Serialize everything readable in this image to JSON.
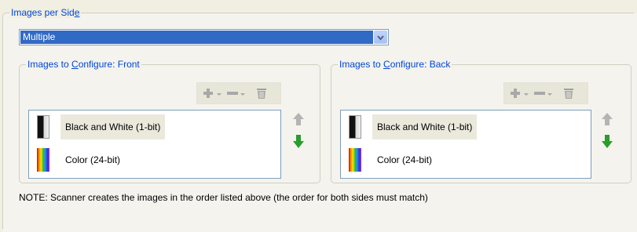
{
  "images_per_side": {
    "legend_prefix": "Images per Sid",
    "legend_hotkey": "e",
    "selected_value": "Multiple"
  },
  "front_panel": {
    "legend_prefix": "Images to ",
    "legend_hotkey": "C",
    "legend_suffix": "onfigure: Front",
    "items": [
      {
        "label": "Black and White (1-bit)",
        "icon": "black-white-icon"
      },
      {
        "label": "Color (24-bit)",
        "icon": "color-icon"
      }
    ]
  },
  "back_panel": {
    "legend_prefix": "Images to ",
    "legend_hotkey": "C",
    "legend_suffix": "onfigure: Back",
    "items": [
      {
        "label": "Black and White (1-bit)",
        "icon": "black-white-icon"
      },
      {
        "label": "Color (24-bit)",
        "icon": "color-icon"
      }
    ]
  },
  "note": "NOTE: Scanner creates the images in the order listed above (the order for both sides must match)",
  "colors": {
    "accent_blue": "#316ac5",
    "legend_blue": "#0046d5",
    "move_down_green": "#2a9d2a",
    "disabled_gray": "#a8a8a8"
  }
}
